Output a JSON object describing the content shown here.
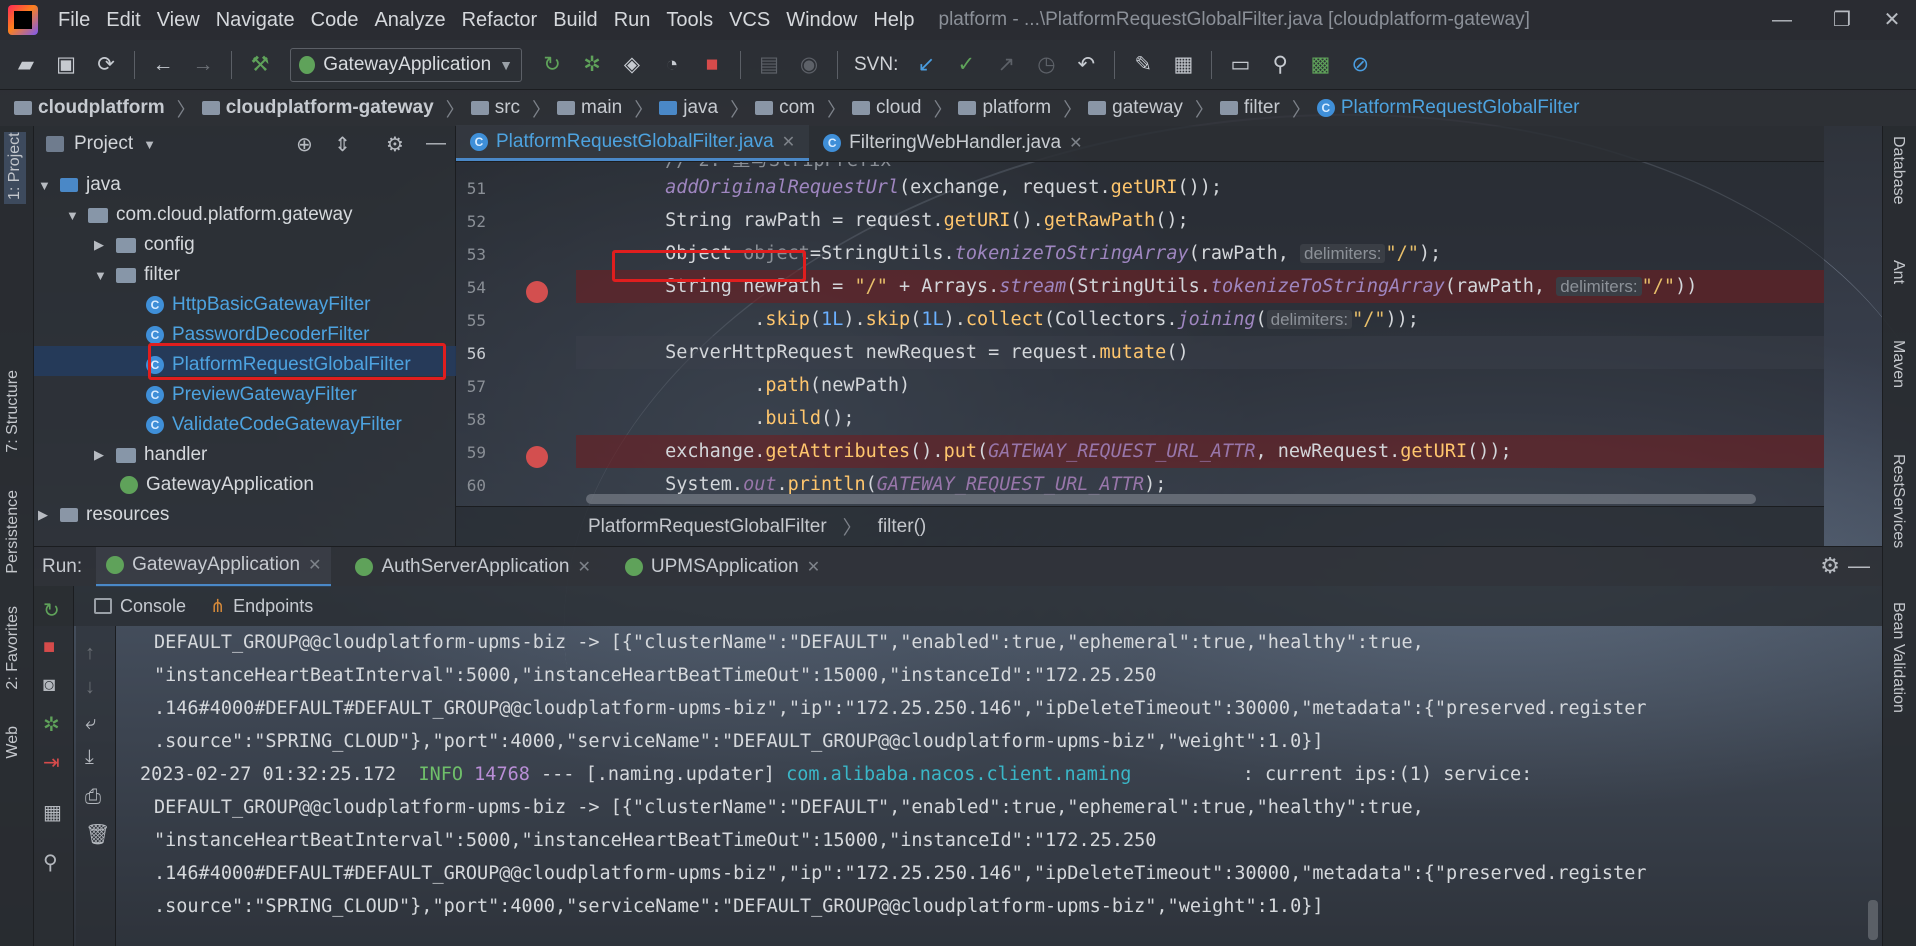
{
  "app": {
    "window_title": "platform - ...\\PlatformRequestGlobalFilter.java [cloudplatform-gateway]"
  },
  "menu": [
    "File",
    "Edit",
    "View",
    "Navigate",
    "Code",
    "Analyze",
    "Refactor",
    "Build",
    "Run",
    "Tools",
    "VCS",
    "Window",
    "Help"
  ],
  "toolbar": {
    "run_config": "GatewayApplication",
    "svn_label": "SVN:"
  },
  "navbar": {
    "crumbs": [
      "cloudplatform",
      "cloudplatform-gateway",
      "src",
      "main",
      "java",
      "com",
      "cloud",
      "platform",
      "gateway",
      "filter",
      "PlatformRequestGlobalFilter"
    ]
  },
  "left_strip": {
    "project": "1: Project",
    "structure": "7: Structure",
    "persistence": "Persistence",
    "favorites": "2: Favorites",
    "web": "Web"
  },
  "right_strip": {
    "database": "Database",
    "ant": "Ant",
    "maven": "Maven",
    "rest": "RestServices",
    "bean": "Bean Validation"
  },
  "project": {
    "title": "Project",
    "tree": [
      {
        "label": "java",
        "depth": 0,
        "kind": "folder",
        "open": true
      },
      {
        "label": "com.cloud.platform.gateway",
        "depth": 1,
        "kind": "package",
        "open": true
      },
      {
        "label": "config",
        "depth": 2,
        "kind": "package",
        "open": false
      },
      {
        "label": "filter",
        "depth": 2,
        "kind": "package",
        "open": true
      },
      {
        "label": "HttpBasicGatewayFilter",
        "depth": 3,
        "kind": "class"
      },
      {
        "label": "PasswordDecoderFilter",
        "depth": 3,
        "kind": "class"
      },
      {
        "label": "PlatformRequestGlobalFilter",
        "depth": 3,
        "kind": "class",
        "selected": true
      },
      {
        "label": "PreviewGatewayFilter",
        "depth": 3,
        "kind": "class"
      },
      {
        "label": "ValidateCodeGatewayFilter",
        "depth": 3,
        "kind": "class"
      },
      {
        "label": "handler",
        "depth": 2,
        "kind": "package",
        "open": false
      },
      {
        "label": "GatewayApplication",
        "depth": 2,
        "kind": "app"
      },
      {
        "label": "resources",
        "depth": 0,
        "kind": "folder",
        "open": false
      }
    ]
  },
  "editor": {
    "tabs": [
      {
        "label": "PlatformRequestGlobalFilter.java",
        "active": true
      },
      {
        "label": "FilteringWebHandler.java",
        "active": false
      }
    ],
    "line_numbers": [
      "51",
      "52",
      "53",
      "54",
      "55",
      "56",
      "57",
      "58",
      "59",
      "60"
    ],
    "breakpoint_lines": [
      "54",
      "59"
    ],
    "breadcrumb": [
      "PlatformRequestGlobalFilter",
      "filter()"
    ],
    "hint_delimiters": "delimiters:",
    "str_slash": "\"/\""
  },
  "run": {
    "label": "Run:",
    "tabs": [
      {
        "label": "GatewayApplication",
        "active": true
      },
      {
        "label": "AuthServerApplication",
        "active": false
      },
      {
        "label": "UPMSApplication",
        "active": false
      }
    ],
    "subtabs": [
      "Console",
      "Endpoints"
    ],
    "console": {
      "l1": "DEFAULT_GROUP@@cloudplatform-upms-biz -> [{\"clusterName\":\"DEFAULT\",\"enabled\":true,\"ephemeral\":true,\"healthy\":true,",
      "l2": "\"instanceHeartBeatInterval\":5000,\"instanceHeartBeatTimeOut\":15000,\"instanceId\":\"172.25.250",
      "l3": ".146#4000#DEFAULT#DEFAULT_GROUP@@cloudplatform-upms-biz\",\"ip\":\"172.25.250.146\",\"ipDeleteTimeout\":30000,\"metadata\":{\"preserved.register",
      "l4": ".source\":\"SPRING_CLOUD\"},\"port\":4000,\"serviceName\":\"DEFAULT_GROUP@@cloudplatform-upms-biz\",\"weight\":1.0}]",
      "ts": "2023-02-27 01:32:25.172",
      "level": "INFO",
      "pid": "14768",
      "thread": "--- [.naming.updater]",
      "logger": "com.alibaba.nacos.client.naming",
      "msg": ": current ips:(1) service:"
    }
  }
}
